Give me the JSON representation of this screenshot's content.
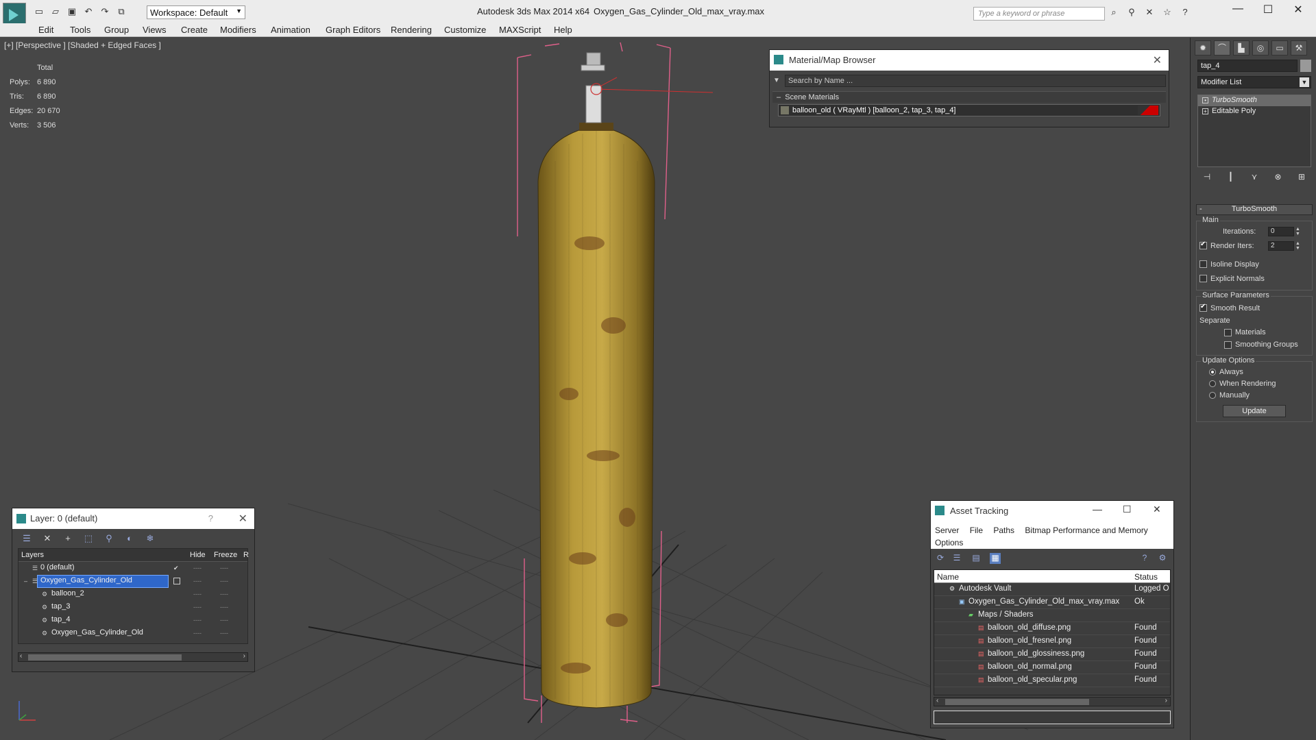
{
  "titlebar": {
    "workspace": "Workspace: Default",
    "app_title": "Autodesk 3ds Max  2014 x64",
    "file_name": "Oxygen_Gas_Cylinder_Old_max_vray.max",
    "search_placeholder": "Type a keyword or phrase"
  },
  "menu": [
    "Edit",
    "Tools",
    "Group",
    "Views",
    "Create",
    "Modifiers",
    "Animation",
    "Graph Editors",
    "Rendering",
    "Customize",
    "MAXScript",
    "Help"
  ],
  "viewport": {
    "label": "[+] [Perspective ] [Shaded + Edged Faces ]",
    "stats": {
      "header": "Total",
      "polys_label": "Polys:",
      "polys": "6 890",
      "tris_label": "Tris:",
      "tris": "6 890",
      "edges_label": "Edges:",
      "edges": "20 670",
      "verts_label": "Verts:",
      "verts": "3 506"
    }
  },
  "material_browser": {
    "title": "Material/Map Browser",
    "search_placeholder": "Search by Name ...",
    "section": "Scene Materials",
    "item": "balloon_old  ( VRayMtl )  [balloon_2, tap_3, tap_4]"
  },
  "command_panel": {
    "object_name": "tap_4",
    "modifier_list": "Modifier List",
    "stack": [
      "TurboSmooth",
      "Editable Poly"
    ],
    "rollout_title": "TurboSmooth",
    "main_group": "Main",
    "iterations_label": "Iterations:",
    "iterations": "0",
    "render_iters_label": "Render Iters:",
    "render_iters": "2",
    "isoline": "Isoline Display",
    "explicit_normals": "Explicit Normals",
    "surface_group": "Surface Parameters",
    "smooth_result": "Smooth Result",
    "separate": "Separate",
    "materials": "Materials",
    "smoothing_groups": "Smoothing Groups",
    "update_group": "Update Options",
    "always": "Always",
    "when_rendering": "When Rendering",
    "manually": "Manually",
    "update_button": "Update"
  },
  "layer_dialog": {
    "title": "Layer: 0 (default)",
    "help": "?",
    "col_layers": "Layers",
    "col_hide": "Hide",
    "col_freeze": "Freeze",
    "col_r": "R",
    "rows": [
      {
        "name": "0 (default)"
      },
      {
        "name": "Oxygen_Gas_Cylinder_Old"
      },
      {
        "name": "balloon_2"
      },
      {
        "name": "tap_3"
      },
      {
        "name": "tap_4"
      },
      {
        "name": "Oxygen_Gas_Cylinder_Old"
      }
    ]
  },
  "asset_tracking": {
    "title": "Asset Tracking",
    "menu": [
      "Server",
      "File",
      "Paths",
      "Bitmap Performance and Memory"
    ],
    "menu_options": "Options",
    "col_name": "Name",
    "col_status": "Status",
    "rows": [
      {
        "name": "Autodesk Vault",
        "status": "Logged O"
      },
      {
        "name": "Oxygen_Gas_Cylinder_Old_max_vray.max",
        "status": "Ok"
      },
      {
        "name": "Maps / Shaders",
        "status": ""
      },
      {
        "name": "balloon_old_diffuse.png",
        "status": "Found"
      },
      {
        "name": "balloon_old_fresnel.png",
        "status": "Found"
      },
      {
        "name": "balloon_old_glossiness.png",
        "status": "Found"
      },
      {
        "name": "balloon_old_normal.png",
        "status": "Found"
      },
      {
        "name": "balloon_old_specular.png",
        "status": "Found"
      }
    ]
  },
  "colors": {
    "accent_selection": "#2f67c9",
    "stats_text": "#f0e070",
    "bounding_box": "#e0608a",
    "cylinder": "#b89a3a"
  }
}
